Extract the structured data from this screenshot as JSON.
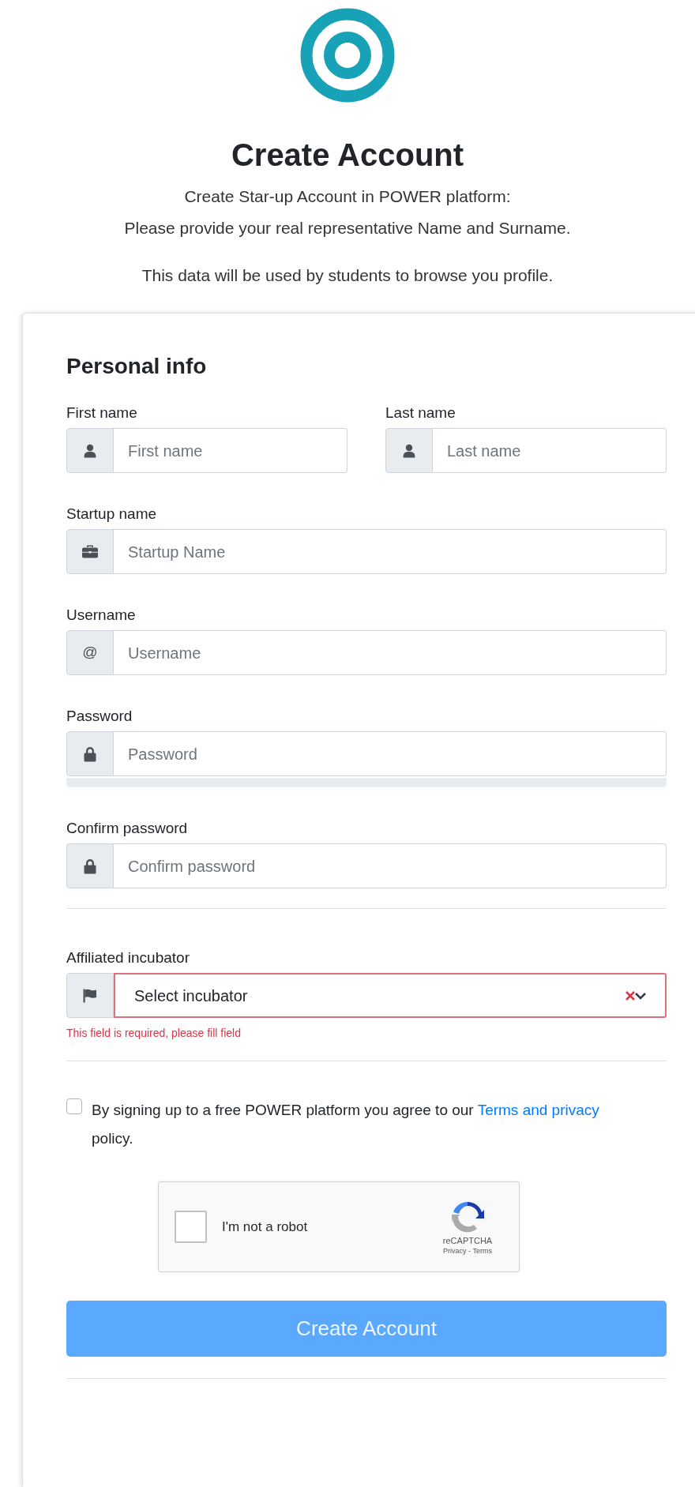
{
  "header": {
    "title": "Create Account",
    "subtitle_lines": [
      "Create Star-up Account in POWER platform:",
      "Please provide your real representative Name and Surname."
    ],
    "note": "This data will be used by students to browse you profile."
  },
  "form": {
    "heading": "Personal info",
    "rows": [
      [
        {
          "label": "First name",
          "placeholder": "First name"
        },
        {
          "label": "Last name",
          "placeholder": "Last name"
        }
      ],
      [
        {
          "label": "Startup name",
          "placeholder": "Startup Name"
        }
      ],
      [
        {
          "label": "Username",
          "placeholder": "Username",
          "addon_text": "@"
        }
      ],
      [
        {
          "label": "Password",
          "placeholder": "Password"
        }
      ],
      [
        {
          "label": "Confirm password",
          "placeholder": "Confirm password"
        }
      ]
    ],
    "incubator": {
      "label": "Affiliated incubator",
      "placeholder": "Select incubator",
      "invalid": true,
      "error": "This field is required, please fill field"
    },
    "terms": {
      "checked": false,
      "text_before": "By signing up to a free POWER platform you agree to our",
      "link": "Terms and privacy",
      "text_after": "policy."
    },
    "captcha": {
      "checked": false,
      "label": "I'm not a robot",
      "brand": "reCAPTCHA",
      "links": "Privacy - Terms"
    },
    "submit": {
      "label": "Create Account",
      "disabled": true
    }
  }
}
